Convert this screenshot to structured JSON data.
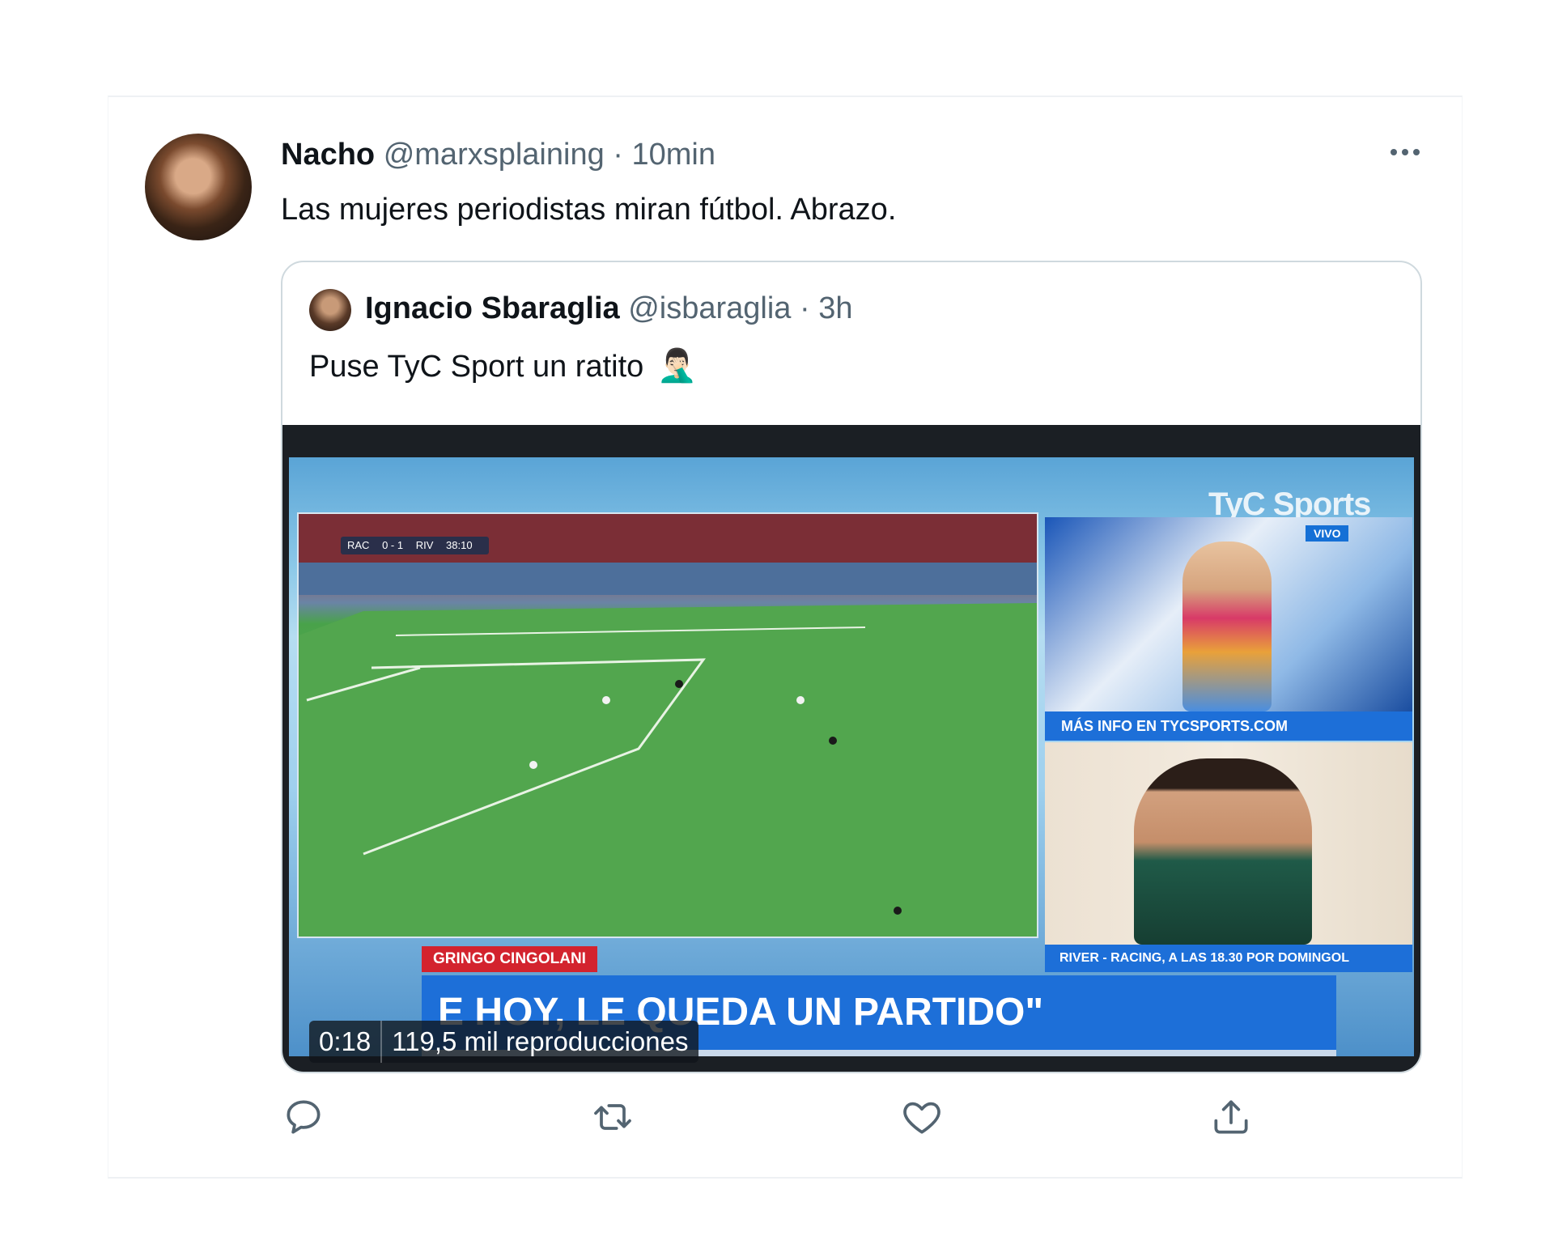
{
  "tweet": {
    "author_name": "Nacho",
    "author_handle": "@marxsplaining",
    "separator": "·",
    "time": "10min",
    "text": "Las mujeres periodistas miran fútbol. Abrazo."
  },
  "quoted_tweet": {
    "author_name": "Ignacio Sbaraglia",
    "author_handle": "@isbaraglia",
    "separator": "·",
    "time": "3h",
    "text": "Puse TyC Sport un ratito",
    "emoji": "🤦🏻‍♂️"
  },
  "video": {
    "duration": "0:18",
    "views": "119,5 mil reproducciones",
    "frame": {
      "brand": "TyC Sports",
      "live": "VIVO",
      "scorebug": [
        "RAC",
        "0 - 1",
        "RIV",
        "38:10"
      ],
      "info_bar": "MÁS INFO EN TYCSPORTS.COM",
      "promo_bar": "RIVER - RACING, A LAS 18.30 POR DOMINGOL",
      "name_tag": "GRINGO CINGOLANI",
      "headline": "E HOY, LE QUEDA UN PARTIDO\""
    }
  },
  "actions": {
    "reply_icon": "reply-icon",
    "retweet_icon": "retweet-icon",
    "like_icon": "heart-icon",
    "share_icon": "share-icon"
  },
  "colors": {
    "text": "#0f1419",
    "secondary": "#536471",
    "border": "#cfd9de",
    "tyc_blue": "#1d6fd8",
    "tyc_red": "#d3232e"
  }
}
